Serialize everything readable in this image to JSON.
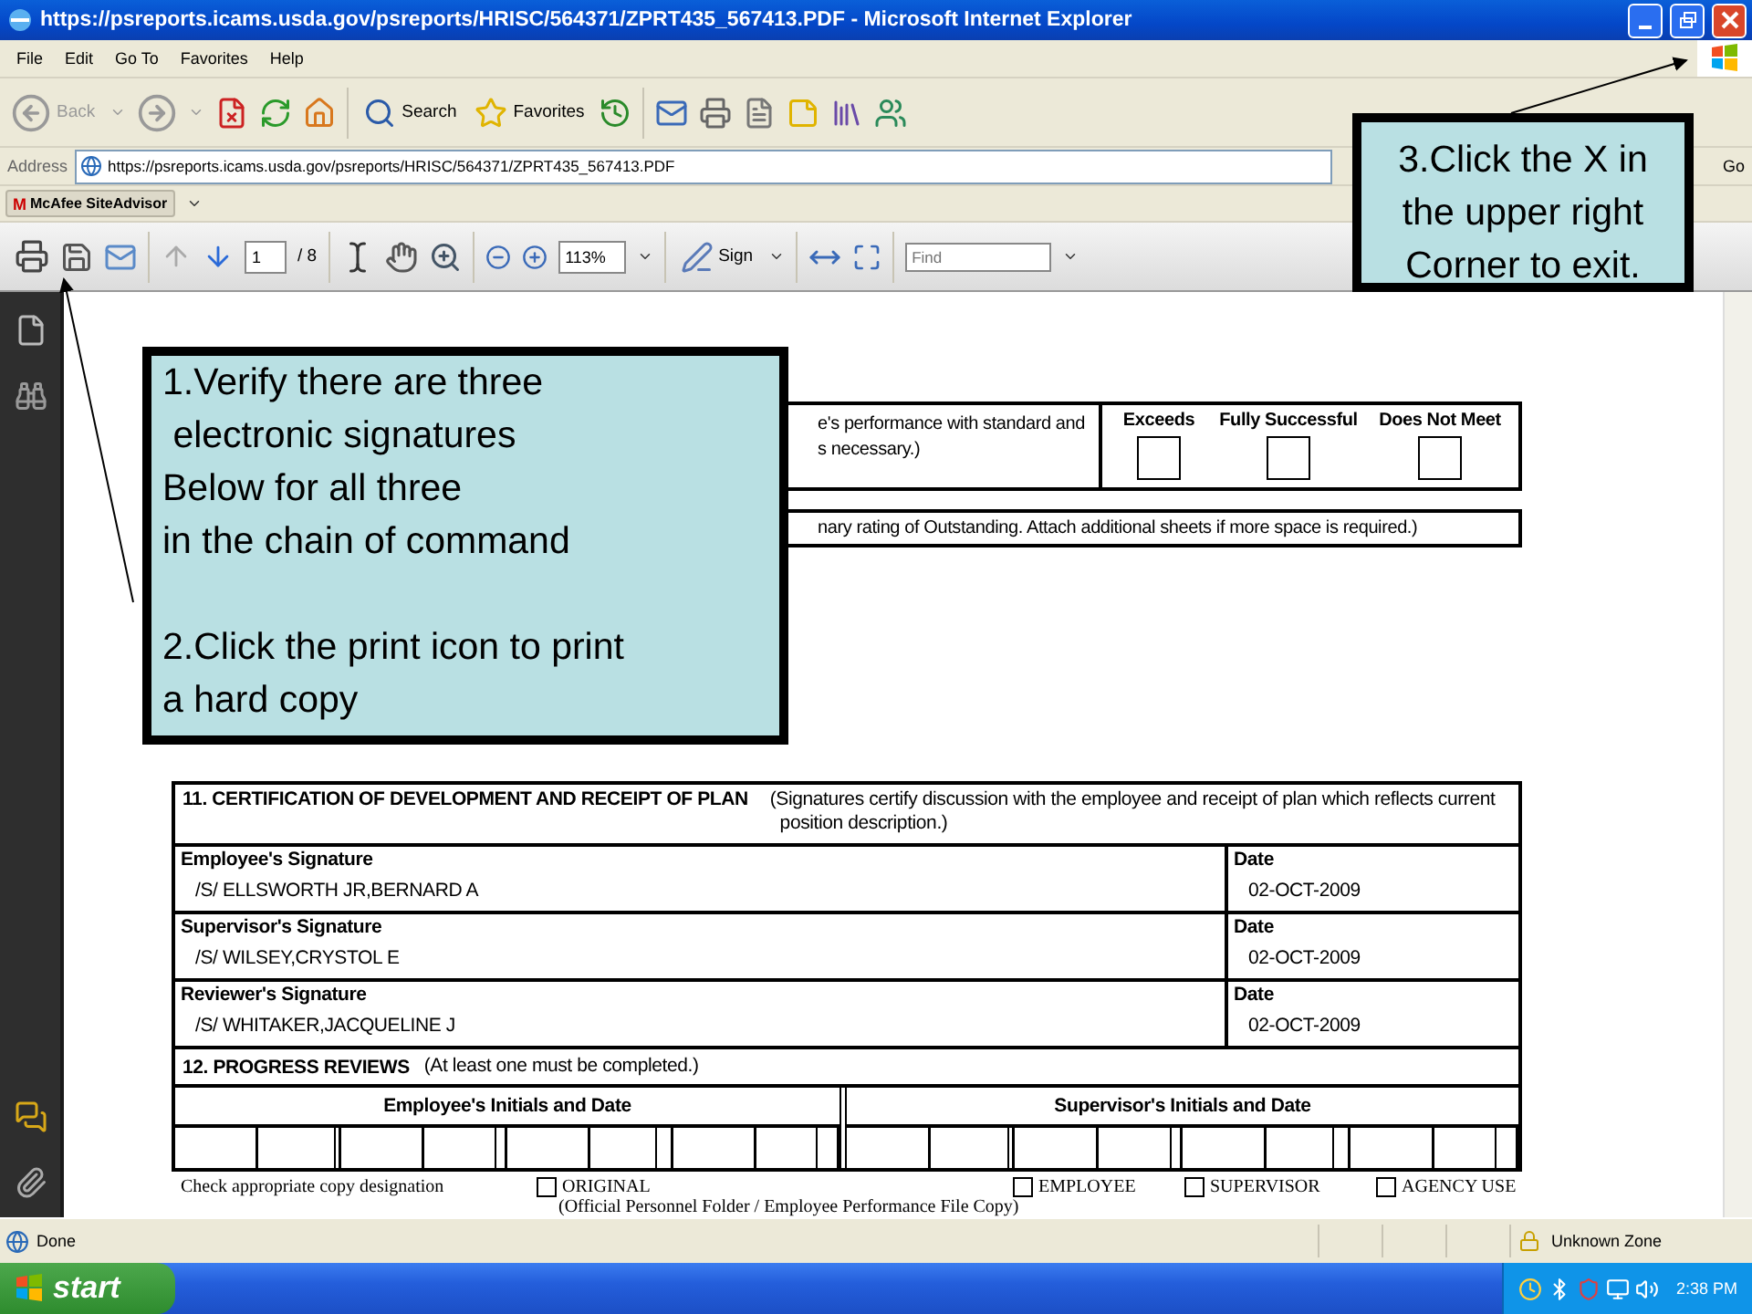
{
  "window": {
    "title": "https://psreports.icams.usda.gov/psreports/HRISC/564371/ZPRT435_567413.PDF - Microsoft Internet Explorer"
  },
  "menu": [
    "File",
    "Edit",
    "Go To",
    "Favorites",
    "Help"
  ],
  "toolbar": {
    "back": "Back",
    "search": "Search",
    "favorites": "Favorites"
  },
  "address": {
    "label": "Address",
    "value": "https://psreports.icams.usda.gov/psreports/HRISC/564371/ZPRT435_567413.PDF",
    "go": "Go"
  },
  "links_bar": {
    "mcafee_logo": "M",
    "mcafee": "McAfee SiteAdvisor"
  },
  "pdf_toolbar": {
    "page": "1",
    "page_count": "/ 8",
    "zoom": "113%",
    "sign": "Sign",
    "find_placeholder": "Find"
  },
  "document": {
    "rating_row": {
      "text_lines": [
        "e's performance with standard and",
        "s necessary.)"
      ],
      "ratings": [
        {
          "label": "Exceeds",
          "checked": false
        },
        {
          "label": "Fully Successful",
          "checked": false
        },
        {
          "label": "Does Not Meet",
          "checked": false
        }
      ]
    },
    "note_row": "nary rating of Outstanding.  Attach additional sheets if more space is required.)",
    "certification": {
      "title": "11. CERTIFICATION OF DEVELOPMENT AND RECEIPT OF PLAN",
      "note_lines": [
        "(Signatures certify discussion with the employee and receipt of plan which reflects current",
        "position description.)"
      ],
      "signatures": [
        {
          "label": "Employee's Signature",
          "name": "/S/ ELLSWORTH JR,BERNARD A",
          "date_label": "Date",
          "date": "02-OCT-2009"
        },
        {
          "label": "Supervisor's Signature",
          "name": "/S/ WILSEY,CRYSTOL E",
          "date_label": "Date",
          "date": "02-OCT-2009"
        },
        {
          "label": "Reviewer's Signature",
          "name": "/S/ WHITAKER,JACQUELINE J",
          "date_label": "Date",
          "date": "02-OCT-2009"
        }
      ]
    },
    "progress_reviews": {
      "title": "12. PROGRESS REVIEWS",
      "note": "(At least one must be completed.)",
      "columns": [
        "Employee's Initials and Date",
        "Supervisor's Initials and Date"
      ]
    },
    "copy_designation": {
      "label": "Check appropriate copy designation",
      "options": [
        {
          "label": "ORIGINAL",
          "sub": "(Official Personnel Folder / Employee Performance File Copy)",
          "checked": false
        },
        {
          "label": "EMPLOYEE",
          "checked": false
        },
        {
          "label": "SUPERVISOR",
          "checked": false
        },
        {
          "label": "AGENCY USE",
          "checked": false
        }
      ]
    }
  },
  "callouts": [
    {
      "kind": "right",
      "paragraphs": [
        [
          "3.Click the X in",
          "the upper right",
          "Corner to exit."
        ]
      ]
    },
    {
      "kind": "left",
      "paragraphs": [
        [
          "1.Verify there are three",
          " electronic signatures",
          "Below for all three",
          "in the chain of command"
        ],
        [
          "2.Click the print icon to print",
          "a hard copy"
        ]
      ]
    }
  ],
  "status_bar": {
    "status": "Done",
    "zone": "Unknown Zone"
  },
  "taskbar": {
    "start": "start",
    "clock": "2:38 PM"
  }
}
